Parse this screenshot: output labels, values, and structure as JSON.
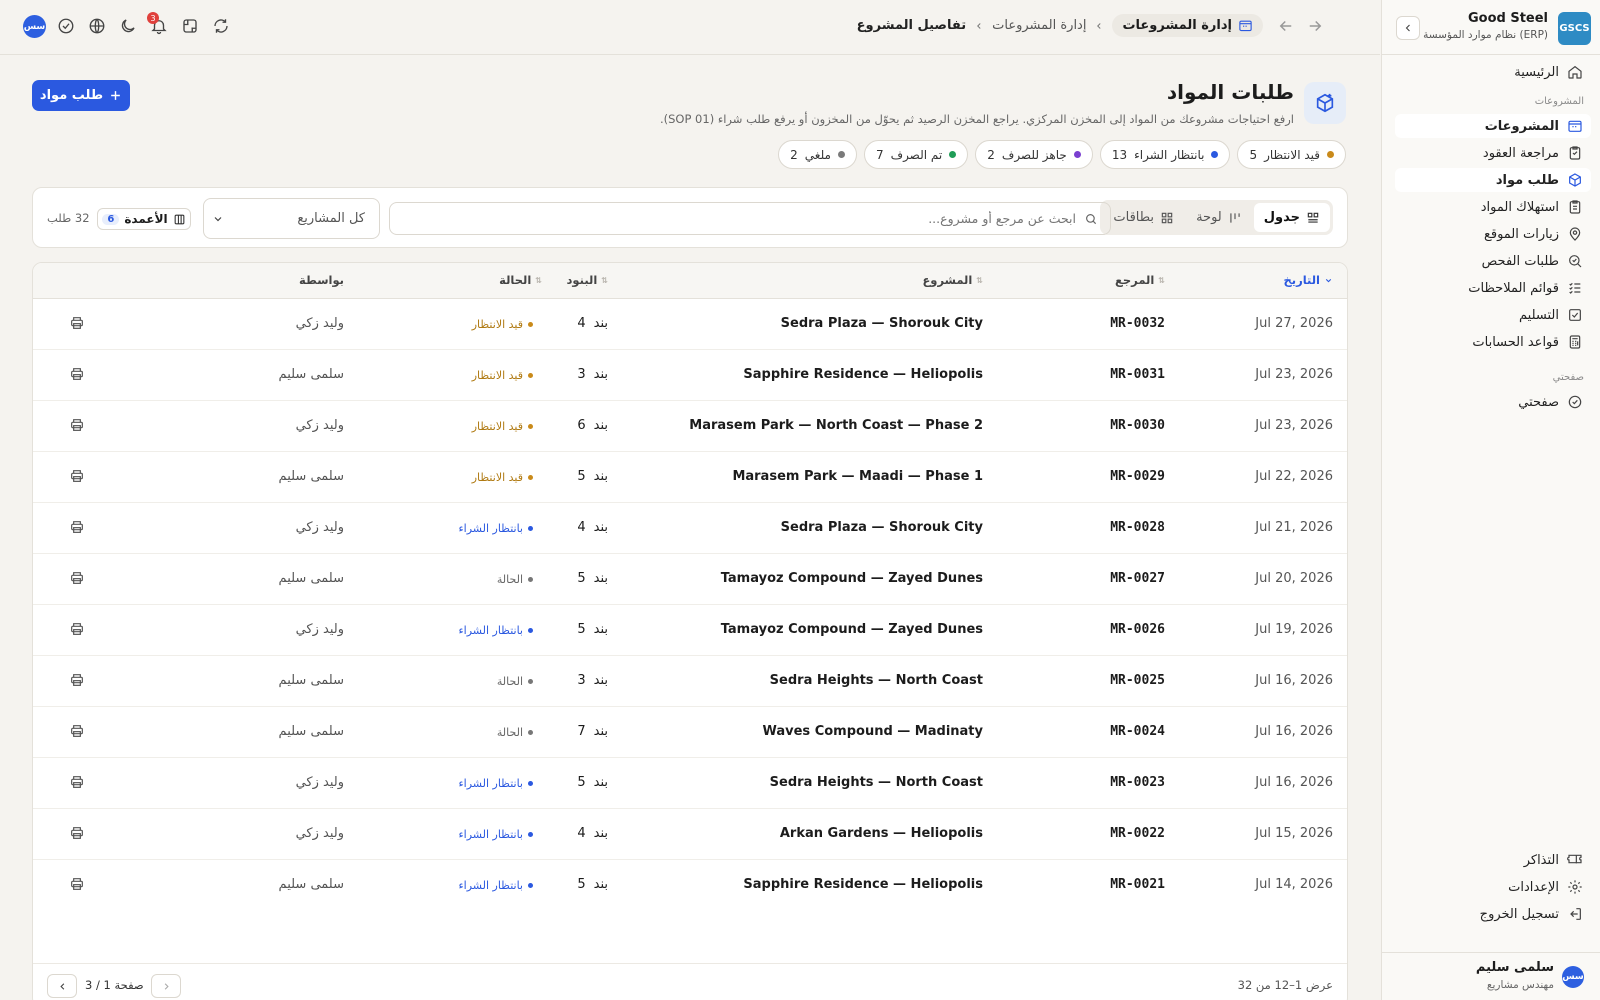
{
  "sidebar": {
    "brand_logo": "GSCS",
    "brand_name": "Good Steel",
    "brand_sub": "نظام موارد المؤسسة (ERP)",
    "home": "الرئيسية",
    "section_projects": "المشروعات",
    "items": [
      {
        "label": "المشروعات",
        "icon": "projects-icon",
        "active": true
      },
      {
        "label": "مراجعة العقود",
        "icon": "clipboard-icon",
        "active": false
      },
      {
        "label": "طلب مواد",
        "icon": "package-icon",
        "active": true
      },
      {
        "label": "استهلاك المواد",
        "icon": "clipboard-list-icon",
        "active": false
      },
      {
        "label": "زيارات الموقع",
        "icon": "map-pin-icon",
        "active": false
      },
      {
        "label": "طلبات الفحص",
        "icon": "inspect-icon",
        "active": false
      },
      {
        "label": "قوائم الملاحظات",
        "icon": "checklist-icon",
        "active": false
      },
      {
        "label": "التسليم",
        "icon": "check-square-icon",
        "active": false
      },
      {
        "label": "قواعد الحسابات",
        "icon": "calculator-icon",
        "active": false
      }
    ],
    "section_mypage": "صفحتي",
    "mypage": "صفحتي",
    "bottom": [
      {
        "label": "التذاكر",
        "icon": "ticket-icon"
      },
      {
        "label": "الإعدادات",
        "icon": "gear-icon"
      },
      {
        "label": "تسجيل الخروج",
        "icon": "logout-icon"
      }
    ],
    "user": {
      "initials": "سس",
      "name": "سلمى سليم",
      "role": "مهندس مشاريع"
    }
  },
  "topbar": {
    "avatar": "سس",
    "notifications_count": "3",
    "crumbs": [
      "إدارة المشروعات",
      "إدارة المشروعات",
      "تفاصيل المشروع"
    ]
  },
  "page": {
    "title": "طلبات المواد",
    "subtitle": "ارفع احتياجات مشروعك من المواد إلى المخزن المركزي. يراجع المخزن الرصيد ثم يحوّل من المخزون أو يرفع طلب شراء (SOP 01).",
    "new_button": "طلب مواد"
  },
  "chips": [
    {
      "label": "قيد الانتظار",
      "count": "5",
      "color": "#c98a1a"
    },
    {
      "label": "بانتظار الشراء",
      "count": "13",
      "color": "#2b59e0"
    },
    {
      "label": "جاهز للصرف",
      "count": "2",
      "color": "#7a3fd0"
    },
    {
      "label": "تم الصرف",
      "count": "7",
      "color": "#1f9d57"
    },
    {
      "label": "ملغي",
      "count": "2",
      "color": "#7a7a7a"
    }
  ],
  "toolbar": {
    "views": [
      "جدول",
      "لوحة",
      "بطاقات"
    ],
    "search_placeholder": "ابحث عن مرجع أو مشروع...",
    "project_filter": "كل المشاريع",
    "columns_label": "الأعمدة",
    "columns_count": "6",
    "total": "32 طلب"
  },
  "table": {
    "headers": {
      "date": "التاريخ",
      "ref": "المرجع",
      "project": "المشروع",
      "items": "البنود",
      "status": "الحالة",
      "by": "بواسطة"
    },
    "item_word": "بند",
    "rows": [
      {
        "date": "Jul 27, 2026",
        "ref": "MR-0032",
        "project": "Sedra Plaza — Shorouk City",
        "items": "4",
        "status": "قيد الانتظار",
        "status_color": "#b07a12",
        "dot": "#c98a1a",
        "by": "وليد زكي"
      },
      {
        "date": "Jul 23, 2026",
        "ref": "MR-0031",
        "project": "Sapphire Residence — Heliopolis",
        "items": "3",
        "status": "قيد الانتظار",
        "status_color": "#b07a12",
        "dot": "#c98a1a",
        "by": "سلمى سليم"
      },
      {
        "date": "Jul 23, 2026",
        "ref": "MR-0030",
        "project": "Marasem Park — North Coast — Phase 2",
        "items": "6",
        "status": "قيد الانتظار",
        "status_color": "#b07a12",
        "dot": "#c98a1a",
        "by": "وليد زكي"
      },
      {
        "date": "Jul 22, 2026",
        "ref": "MR-0029",
        "project": "Marasem Park — Maadi — Phase 1",
        "items": "5",
        "status": "قيد الانتظار",
        "status_color": "#b07a12",
        "dot": "#c98a1a",
        "by": "سلمى سليم"
      },
      {
        "date": "Jul 21, 2026",
        "ref": "MR-0028",
        "project": "Sedra Plaza — Shorouk City",
        "items": "4",
        "status": "بانتظار الشراء",
        "status_color": "#2b59e0",
        "dot": "#2b59e0",
        "by": "وليد زكي"
      },
      {
        "date": "Jul 20, 2026",
        "ref": "MR-0027",
        "project": "Tamayoz Compound — Zayed Dunes",
        "items": "5",
        "status": "الحالة",
        "status_color": "#666666",
        "dot": "#777777",
        "by": "سلمى سليم"
      },
      {
        "date": "Jul 19, 2026",
        "ref": "MR-0026",
        "project": "Tamayoz Compound — Zayed Dunes",
        "items": "5",
        "status": "بانتظار الشراء",
        "status_color": "#2b59e0",
        "dot": "#2b59e0",
        "by": "وليد زكي"
      },
      {
        "date": "Jul 16, 2026",
        "ref": "MR-0025",
        "project": "Sedra Heights — North Coast",
        "items": "3",
        "status": "الحالة",
        "status_color": "#666666",
        "dot": "#777777",
        "by": "سلمى سليم"
      },
      {
        "date": "Jul 16, 2026",
        "ref": "MR-0024",
        "project": "Waves Compound — Madinaty",
        "items": "7",
        "status": "الحالة",
        "status_color": "#666666",
        "dot": "#777777",
        "by": "سلمى سليم"
      },
      {
        "date": "Jul 16, 2026",
        "ref": "MR-0023",
        "project": "Sedra Heights — North Coast",
        "items": "5",
        "status": "بانتظار الشراء",
        "status_color": "#2b59e0",
        "dot": "#2b59e0",
        "by": "وليد زكي"
      },
      {
        "date": "Jul 15, 2026",
        "ref": "MR-0022",
        "project": "Arkan Gardens — Heliopolis",
        "items": "4",
        "status": "بانتظار الشراء",
        "status_color": "#2b59e0",
        "dot": "#2b59e0",
        "by": "وليد زكي"
      },
      {
        "date": "Jul 14, 2026",
        "ref": "MR-0021",
        "project": "Sapphire Residence — Heliopolis",
        "items": "5",
        "status": "بانتظار الشراء",
        "status_color": "#2b59e0",
        "dot": "#2b59e0",
        "by": "سلمى سليم"
      }
    ]
  },
  "pagination": {
    "range": "عرض 1–12 من 32",
    "page": "صفحة 1 / 3"
  }
}
